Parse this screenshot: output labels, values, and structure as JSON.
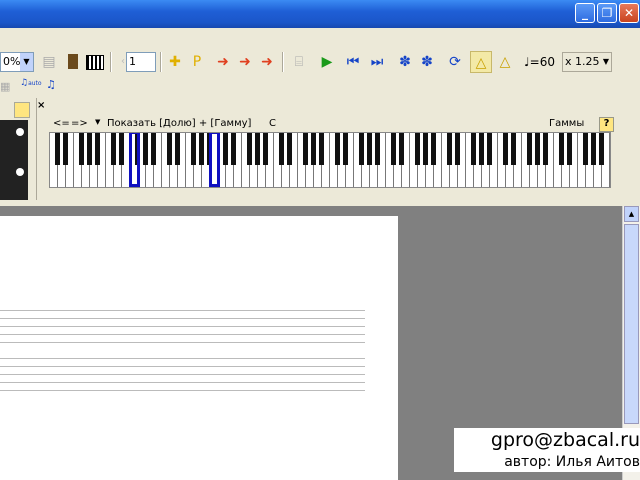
{
  "window": {
    "min_label": "_",
    "restore_label": "❐",
    "close_label": "✕"
  },
  "toolbar": {
    "zoom_value": "0%",
    "page_number": "1",
    "tempo_value": "60",
    "speed_value": "x 1.25"
  },
  "toolbar2": {
    "auto_label": "auto"
  },
  "keyboard_panel": {
    "prev_label": "<=",
    "next_label": "=>",
    "show_label": "Показать [Долю] + [Гамму]",
    "note_label": "C",
    "scales_label": "Гаммы",
    "help_label": "?",
    "close_label": "×"
  },
  "watermark": {
    "email": "gpro@zbacal.ru",
    "author": "автор: Илья Аитов"
  },
  "colors": {
    "title_bar": "#1f5fd6",
    "highlight": "#1010c0",
    "play": "#1a9a1a"
  }
}
